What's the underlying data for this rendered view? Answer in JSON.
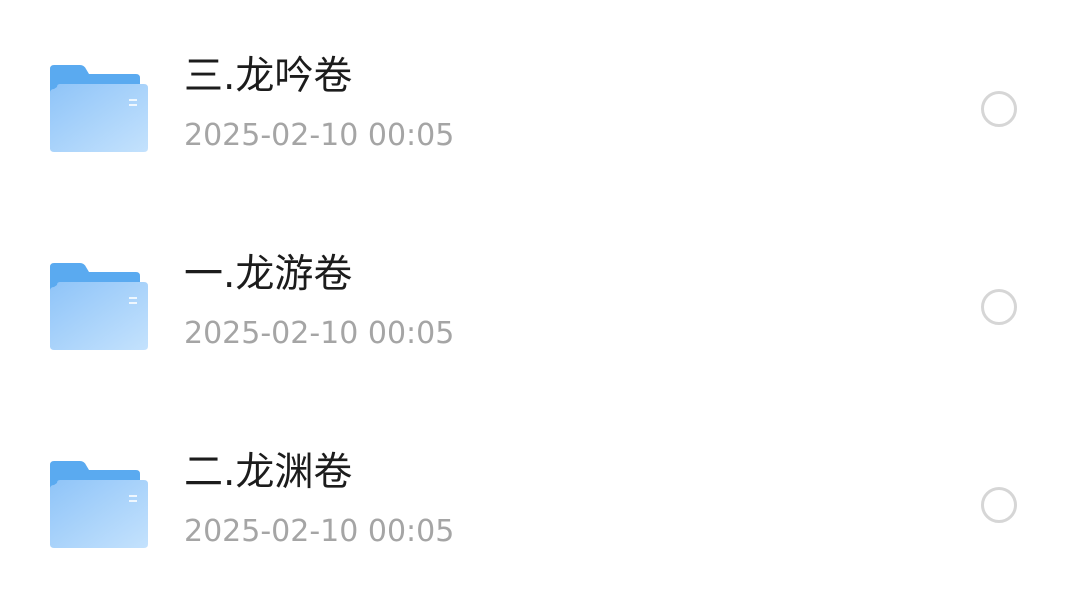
{
  "files": [
    {
      "name": "三.龙吟卷",
      "modified": "2025-02-10 00:05",
      "icon": "folder-icon",
      "selected": false
    },
    {
      "name": "一.龙游卷",
      "modified": "2025-02-10 00:05",
      "icon": "folder-icon",
      "selected": false
    },
    {
      "name": "二.龙渊卷",
      "modified": "2025-02-10 00:05",
      "icon": "folder-icon",
      "selected": false
    }
  ],
  "colors": {
    "folder_back": "#5aaaf0",
    "folder_front": "#a8d2fb",
    "title": "#1c1c1c",
    "date": "#a5a5a5",
    "radio_border": "#d6d6d6"
  }
}
